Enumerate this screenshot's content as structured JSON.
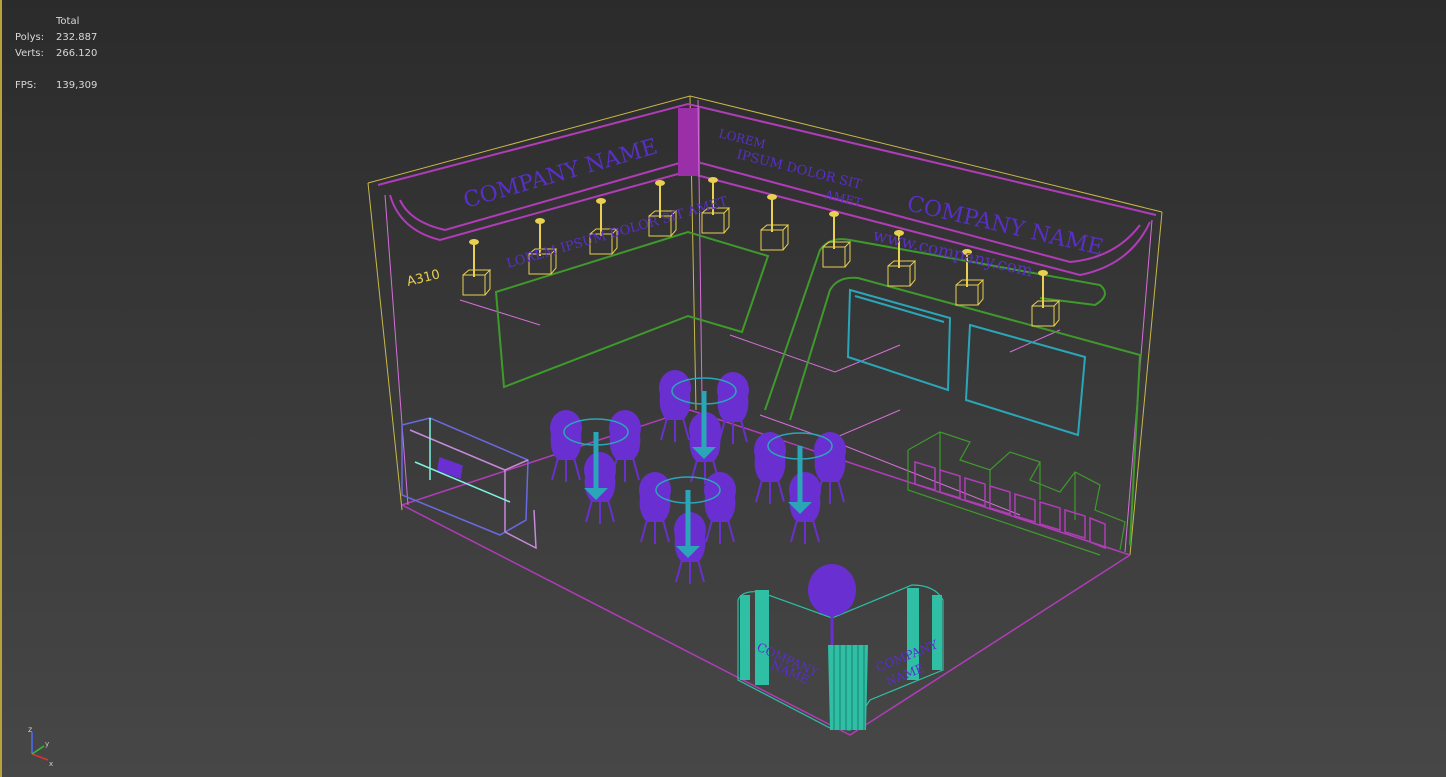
{
  "stats": {
    "header": "Total",
    "polys_label": "Polys:",
    "polys_value": "232.887",
    "verts_label": "Verts:",
    "verts_value": "266.120",
    "fps_label": "FPS:",
    "fps_value": "139,309"
  },
  "scene": {
    "booth_number": "A310",
    "left_wall_title": "COMPANY NAME",
    "left_wall_sub": "LOREM IPSUM DOLOR SIT AMET",
    "corner_text_1": "LOREM",
    "corner_text_2": "IPSUM DOLOR SIT",
    "corner_text_3": "AMET",
    "right_wall_title": "COMPANY NAME",
    "right_wall_url": "www.company.com",
    "counter_left_1": "COMPANY",
    "counter_left_2": "NAME",
    "counter_right_1": "COMPANY",
    "counter_right_2": "NAME"
  },
  "axis": {
    "z_label": "z",
    "x_label": "x",
    "y_label": "y"
  },
  "colors": {
    "frame_yellow": "#c8b84a",
    "wire_magenta": "#b03cb8",
    "wire_pink": "#d66fd8",
    "wire_green": "#3f9a2c",
    "wire_cyan": "#2aa6b8",
    "lamp_yellow": "#e8d050",
    "furniture_purple": "#6a2fd0",
    "teal": "#2fbfa4",
    "lettering_purple": "#5a2fc8"
  }
}
